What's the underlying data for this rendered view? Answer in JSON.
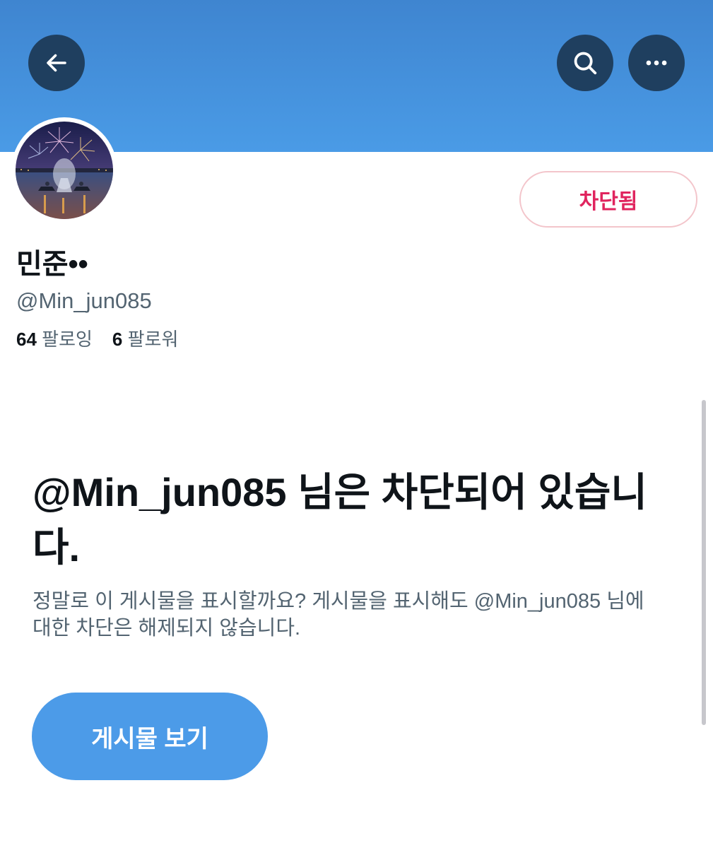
{
  "header": {
    "back_icon": "arrow-left-icon",
    "search_icon": "search-icon",
    "more_icon": "more-horizontal-icon",
    "banner_color": "#4a9be6",
    "button_color": "#1f3f5f"
  },
  "profile": {
    "avatar_description": "fireworks-jetski-avatar",
    "blocked_label": "차단됨",
    "display_name": "민준••",
    "handle": "@Min_jun085",
    "following_count": "64",
    "following_label": "팔로잉",
    "followers_count": "6",
    "followers_label": "팔로워"
  },
  "blocked_notice": {
    "headline": "@Min_jun085 님은 차단되어 있습니다.",
    "description": "정말로 이 게시물을 표시할까요? 게시물을 표시해도 @Min_jun085 님에 대한 차단은 해제되지 않습니다.",
    "view_button_label": "게시물 보기"
  },
  "colors": {
    "blocked_red": "#e0245e",
    "accent_blue": "#4c9be8",
    "secondary_text": "#536471"
  }
}
